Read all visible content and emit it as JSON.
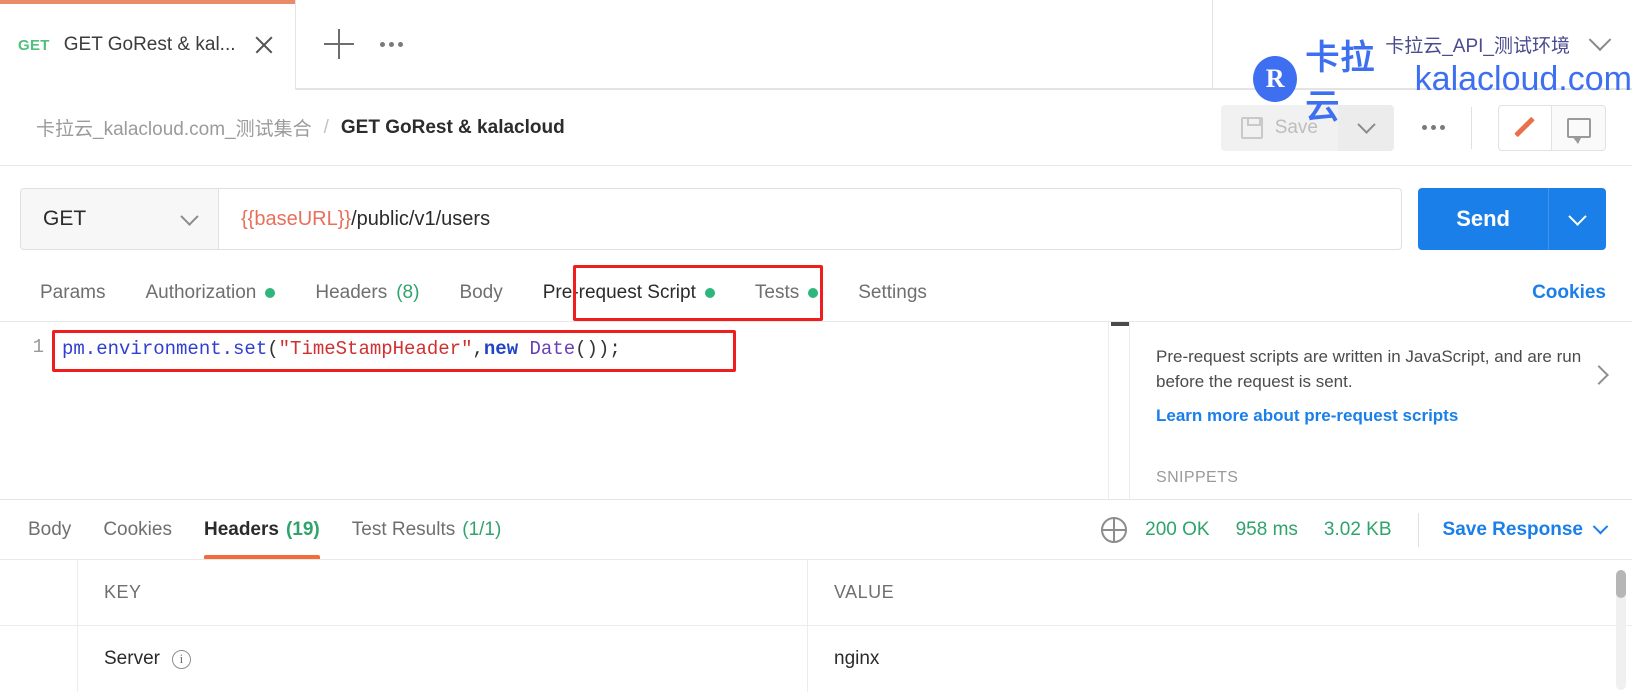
{
  "tabstrip": {
    "tab_method": "GET",
    "tab_title": "GET GoRest & kal...",
    "close_label": "",
    "new_tab_label": "",
    "more_label": "",
    "environment_name": "卡拉云_API_测试环境"
  },
  "watermark": {
    "logo_letter": "R",
    "cn": "卡拉云",
    "en": "kalacloud.com"
  },
  "breadcrumb": {
    "collection": "卡拉云_kalacloud.com_测试集合",
    "separator": "/",
    "current": "GET GoRest & kalacloud",
    "save_label": "Save"
  },
  "request": {
    "method": "GET",
    "url_variable": "{{baseURL}}",
    "url_path": "/public/v1/users",
    "send_label": "Send"
  },
  "request_tabs": [
    {
      "label": "Params",
      "dot": false,
      "count": "",
      "active": false
    },
    {
      "label": "Authorization",
      "dot": true,
      "count": "",
      "active": false
    },
    {
      "label": "Headers",
      "dot": false,
      "count": "(8)",
      "active": false
    },
    {
      "label": "Body",
      "dot": false,
      "count": "",
      "active": false
    },
    {
      "label": "Pre-request Script",
      "dot": true,
      "count": "",
      "active": true
    },
    {
      "label": "Tests",
      "dot": true,
      "count": "",
      "active": false
    },
    {
      "label": "Settings",
      "dot": false,
      "count": "",
      "active": false
    }
  ],
  "cookies_link": "Cookies",
  "editor": {
    "line_number": "1",
    "code_parts": {
      "obj": "pm.environment.set",
      "paren_open": "(",
      "string": "\"TimeStampHeader\"",
      "comma": ",",
      "keyword": "new",
      "space": " ",
      "fn": "Date",
      "tail": "());"
    }
  },
  "help": {
    "text": "Pre-request scripts are written in JavaScript, and are run before the request is sent.",
    "link": "Learn more about pre-request scripts",
    "snippets_label": "SNIPPETS"
  },
  "response_tabs": [
    {
      "label": "Body",
      "count": "",
      "active": false
    },
    {
      "label": "Cookies",
      "count": "",
      "active": false
    },
    {
      "label": "Headers",
      "count": "(19)",
      "active": true
    },
    {
      "label": "Test Results",
      "count": "(1/1)",
      "active": false
    }
  ],
  "response_meta": {
    "status": "200 OK",
    "time": "958 ms",
    "size": "3.02 KB",
    "save_response": "Save Response"
  },
  "headers_table": {
    "columns": [
      "KEY",
      "VALUE"
    ],
    "rows": [
      {
        "key": "Server",
        "value": "nginx"
      }
    ]
  },
  "colors": {
    "accent_orange": "#f26b3a",
    "tab_top_bar": "#e98a6a",
    "send_blue": "#1a7fe8",
    "link_blue": "#1a7fe8",
    "status_green": "#2fa36b",
    "dot_green": "#2eb67d",
    "highlight_red": "#f01d1d",
    "url_var": "#e8705a",
    "watermark_blue": "#3d6ff0"
  }
}
